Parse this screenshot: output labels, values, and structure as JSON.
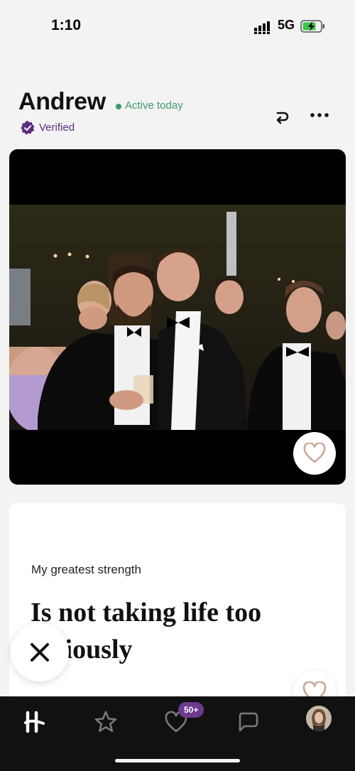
{
  "status_bar": {
    "time": "1:10",
    "network": "5G"
  },
  "profile": {
    "name": "Andrew",
    "activity": "Active today",
    "verified_label": "Verified"
  },
  "prompt": {
    "question": "My greatest strength",
    "answer": "Is not taking life too seriously"
  },
  "nav": {
    "likes_badge": "50+"
  },
  "colors": {
    "accent_green": "#3f9a6c",
    "brand_purple": "#5a2d82",
    "badge_purple": "#6d3a8e",
    "nav_background": "#111111"
  },
  "icons": {
    "header": [
      "undo-icon",
      "more-icon"
    ],
    "card": [
      "heart-icon",
      "close-icon"
    ],
    "nav": [
      "hinge-logo-icon",
      "star-icon",
      "likes-icon",
      "chat-icon",
      "avatar"
    ]
  }
}
